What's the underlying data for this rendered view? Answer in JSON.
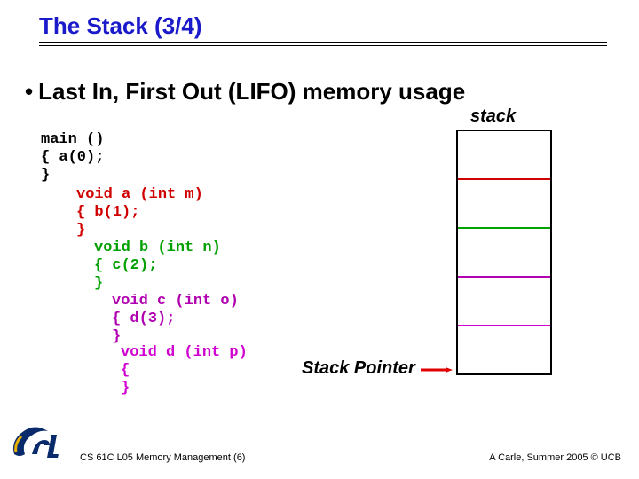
{
  "title": "The Stack (3/4)",
  "bullet": "Last In, First Out (LIFO) memory usage",
  "stack_label": "stack",
  "stack_pointer_label": "Stack Pointer",
  "code": {
    "main": "main ()\n{ a(0);\n}",
    "a": "void a (int m)\n{ b(1);\n}",
    "b": "void b (int n)\n{ c(2);\n}",
    "c": "void c (int o)\n{ d(3);\n}",
    "d": "void d (int p)\n{\n}"
  },
  "colors": {
    "main": "#000000",
    "a": "#d00000",
    "b": "#00a000",
    "c": "#b000b0",
    "d": "#d000d0",
    "arrow": "#e00000"
  },
  "footer_left": "CS 61C L05 Memory Management (6)",
  "footer_right": "A Carle, Summer 2005 © UCB"
}
